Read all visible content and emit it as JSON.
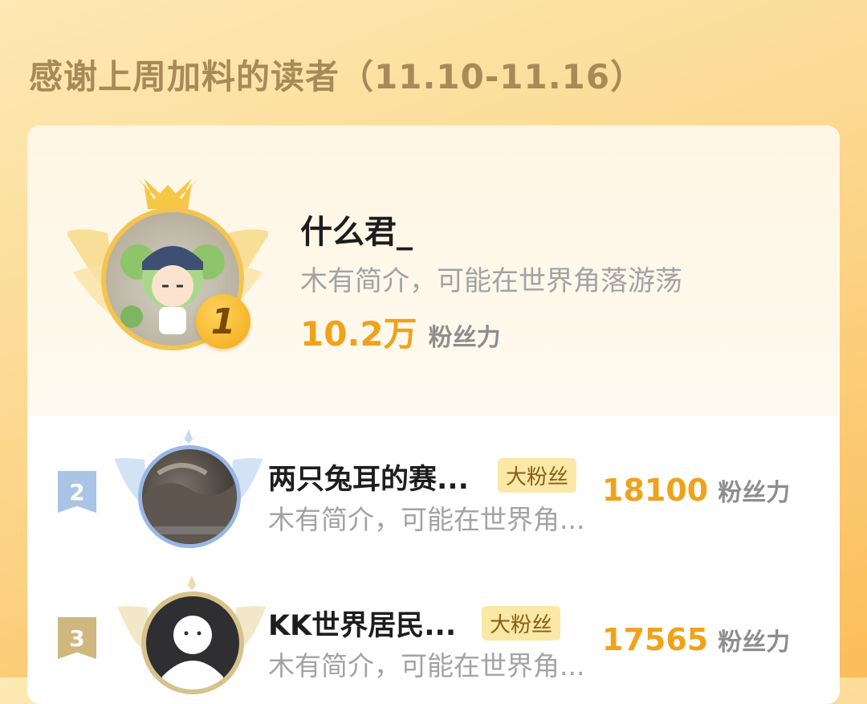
{
  "header": {
    "title": "感谢上周加料的读者（11.10-11.16）"
  },
  "colors": {
    "accent": "#f0a21a",
    "title": "#a78a57",
    "tag_bg": "#fbe8a6"
  },
  "readers": [
    {
      "rank": "1",
      "name": "什么君_",
      "desc": "木有简介，可能在世界角落游荡",
      "fans": "10.2万",
      "unit": "粉丝力"
    },
    {
      "rank": "2",
      "name": "两只兔耳的赛...",
      "tag": "大粉丝",
      "desc": "木有简介，可能在世界角...",
      "fans": "18100",
      "unit": "粉丝力"
    },
    {
      "rank": "3",
      "name": "KK世界居民...",
      "tag": "大粉丝",
      "desc": "木有简介，可能在世界角...",
      "fans": "17565",
      "unit": "粉丝力"
    }
  ]
}
